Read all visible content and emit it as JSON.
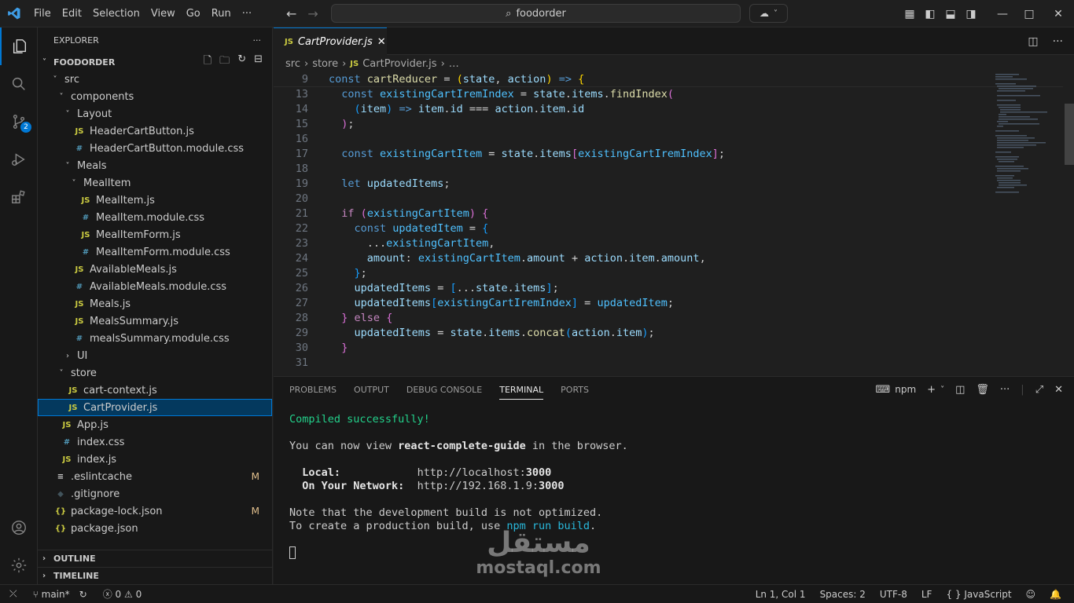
{
  "menu": [
    "File",
    "Edit",
    "Selection",
    "View",
    "Go",
    "Run",
    "···"
  ],
  "search": {
    "text": "foodorder"
  },
  "activity": {
    "scm_badge": "2"
  },
  "explorer": {
    "title": "EXPLORER",
    "workspace": "FOODORDER",
    "tree": [
      {
        "label": "src",
        "indent": 1,
        "chev": "˅",
        "icon": ""
      },
      {
        "label": "components",
        "indent": 2,
        "chev": "˅",
        "icon": ""
      },
      {
        "label": "Layout",
        "indent": 3,
        "chev": "˅",
        "icon": ""
      },
      {
        "label": "HeaderCartButton.js",
        "indent": 4,
        "chev": "",
        "icon": "JS",
        "type": "js"
      },
      {
        "label": "HeaderCartButton.module.css",
        "indent": 4,
        "chev": "",
        "icon": "#",
        "type": "css"
      },
      {
        "label": "Meals",
        "indent": 3,
        "chev": "˅",
        "icon": ""
      },
      {
        "label": "MealItem",
        "indent": 4,
        "chev": "˅",
        "icon": ""
      },
      {
        "label": "MealItem.js",
        "indent": 5,
        "chev": "",
        "icon": "JS",
        "type": "js"
      },
      {
        "label": "MealItem.module.css",
        "indent": 5,
        "chev": "",
        "icon": "#",
        "type": "css"
      },
      {
        "label": "MealItemForm.js",
        "indent": 5,
        "chev": "",
        "icon": "JS",
        "type": "js"
      },
      {
        "label": "MealItemForm.module.css",
        "indent": 5,
        "chev": "",
        "icon": "#",
        "type": "css"
      },
      {
        "label": "AvailableMeals.js",
        "indent": 4,
        "chev": "",
        "icon": "JS",
        "type": "js"
      },
      {
        "label": "AvailableMeals.module.css",
        "indent": 4,
        "chev": "",
        "icon": "#",
        "type": "css"
      },
      {
        "label": "Meals.js",
        "indent": 4,
        "chev": "",
        "icon": "JS",
        "type": "js"
      },
      {
        "label": "MealsSummary.js",
        "indent": 4,
        "chev": "",
        "icon": "JS",
        "type": "js"
      },
      {
        "label": "mealsSummary.module.css",
        "indent": 4,
        "chev": "",
        "icon": "#",
        "type": "css"
      },
      {
        "label": "UI",
        "indent": 3,
        "chev": "›",
        "icon": ""
      },
      {
        "label": "store",
        "indent": 2,
        "chev": "˅",
        "icon": ""
      },
      {
        "label": "cart-context.js",
        "indent": 3,
        "chev": "",
        "icon": "JS",
        "type": "js"
      },
      {
        "label": "CartProvider.js",
        "indent": 3,
        "chev": "",
        "icon": "JS",
        "type": "js",
        "selected": true
      },
      {
        "label": "App.js",
        "indent": 2,
        "chev": "",
        "icon": "JS",
        "type": "js"
      },
      {
        "label": "index.css",
        "indent": 2,
        "chev": "",
        "icon": "#",
        "type": "css"
      },
      {
        "label": "index.js",
        "indent": 2,
        "chev": "",
        "icon": "JS",
        "type": "js"
      },
      {
        "label": ".eslintcache",
        "indent": 1,
        "chev": "",
        "icon": "≡",
        "type": "plain",
        "badge": "M"
      },
      {
        "label": ".gitignore",
        "indent": 1,
        "chev": "",
        "icon": "◆",
        "type": "git"
      },
      {
        "label": "package-lock.json",
        "indent": 1,
        "chev": "",
        "icon": "{}",
        "type": "json",
        "badge": "M"
      },
      {
        "label": "package.json",
        "indent": 1,
        "chev": "",
        "icon": "{}",
        "type": "json"
      }
    ],
    "outline": "OUTLINE",
    "timeline": "TIMELINE"
  },
  "editor": {
    "tab": "CartProvider.js",
    "breadcrumb": [
      "src",
      "store",
      "CartProvider.js",
      "…"
    ],
    "lines": [
      {
        "n": "9",
        "html": "<span class='kw'>const</span> <span class='fn'>cartReducer</span> <span class='op'>=</span> <span class='br1'>(</span><span class='var'>state</span>, <span class='var'>action</span><span class='br1'>)</span> <span class='kw'>=&gt;</span> <span class='br1'>{</span>",
        "sticky": true
      },
      {
        "n": "13",
        "html": "  <span class='kw'>const</span> <span class='cst'>existingCartIremIndex</span> <span class='op'>=</span> <span class='var'>state</span>.<span class='var'>items</span>.<span class='fn'>findIndex</span><span class='br2'>(</span>"
      },
      {
        "n": "14",
        "html": "    <span class='br3'>(</span><span class='var'>item</span><span class='br3'>)</span> <span class='kw'>=&gt;</span> <span class='var'>item</span>.<span class='var'>id</span> <span class='op'>===</span> <span class='var'>action</span>.<span class='var'>item</span>.<span class='var'>id</span>"
      },
      {
        "n": "15",
        "html": "  <span class='br2'>)</span>;"
      },
      {
        "n": "16",
        "html": ""
      },
      {
        "n": "17",
        "html": "  <span class='kw'>const</span> <span class='cst'>existingCartItem</span> <span class='op'>=</span> <span class='var'>state</span>.<span class='var'>items</span><span class='br2'>[</span><span class='cst'>existingCartIremIndex</span><span class='br2'>]</span>;"
      },
      {
        "n": "18",
        "html": ""
      },
      {
        "n": "19",
        "html": "  <span class='kw'>let</span> <span class='var'>updatedItems</span>;"
      },
      {
        "n": "20",
        "html": ""
      },
      {
        "n": "21",
        "html": "  <span class='kw2'>if</span> <span class='br2'>(</span><span class='cst'>existingCartItem</span><span class='br2'>)</span> <span class='br2'>{</span>"
      },
      {
        "n": "22",
        "html": "    <span class='kw'>const</span> <span class='cst'>updatedItem</span> <span class='op'>=</span> <span class='br3'>{</span>"
      },
      {
        "n": "23",
        "html": "      ...<span class='cst'>existingCartItem</span>,"
      },
      {
        "n": "24",
        "html": "      <span class='var'>amount</span>: <span class='cst'>existingCartItem</span>.<span class='var'>amount</span> <span class='op'>+</span> <span class='var'>action</span>.<span class='var'>item</span>.<span class='var'>amount</span>,"
      },
      {
        "n": "25",
        "html": "    <span class='br3'>}</span>;"
      },
      {
        "n": "26",
        "html": "    <span class='var'>updatedItems</span> <span class='op'>=</span> <span class='br3'>[</span>...<span class='var'>state</span>.<span class='var'>items</span><span class='br3'>]</span>;"
      },
      {
        "n": "27",
        "html": "    <span class='var'>updatedItems</span><span class='br3'>[</span><span class='cst'>existingCartIremIndex</span><span class='br3'>]</span> <span class='op'>=</span> <span class='cst'>updatedItem</span>;"
      },
      {
        "n": "28",
        "html": "  <span class='br2'>}</span> <span class='kw2'>else</span> <span class='br2'>{</span>"
      },
      {
        "n": "29",
        "html": "    <span class='var'>updatedItems</span> <span class='op'>=</span> <span class='var'>state</span>.<span class='var'>items</span>.<span class='fn'>concat</span><span class='br3'>(</span><span class='var'>action</span>.<span class='var'>item</span><span class='br3'>)</span>;"
      },
      {
        "n": "30",
        "html": "  <span class='br2'>}</span>"
      },
      {
        "n": "31",
        "html": ""
      }
    ]
  },
  "panel": {
    "tabs": [
      "PROBLEMS",
      "OUTPUT",
      "DEBUG CONSOLE",
      "TERMINAL",
      "PORTS"
    ],
    "active": "TERMINAL",
    "shell": "npm",
    "terminal": {
      "compiled": "Compiled successfully!",
      "view_pre": "You can now view ",
      "app": "react-complete-guide",
      "view_post": " in the browser.",
      "local_label": "Local:",
      "local_url": "http://localhost:",
      "local_port": "3000",
      "net_label": "On Your Network:",
      "net_url": "http://192.168.1.9:",
      "net_port": "3000",
      "note1": "Note that the development build is not optimized.",
      "note2_pre": "To create a production build, use ",
      "note2_cmd": "npm run build",
      "note2_post": "."
    }
  },
  "watermark": {
    "arabic": "مستقل",
    "latin": "mostaql.com"
  },
  "status": {
    "branch": "main*",
    "errors": "0",
    "warnings": "0",
    "position": "Ln 1, Col 1",
    "spaces": "Spaces: 2",
    "encoding": "UTF-8",
    "eol": "LF",
    "language": "JavaScript"
  }
}
